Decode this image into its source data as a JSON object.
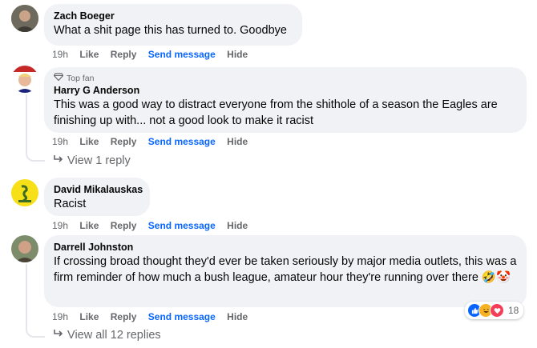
{
  "comments": [
    {
      "name": "Zach Boeger",
      "text": "What a shit page this has turned to. Goodbye",
      "actions": {
        "time": "19h",
        "like": "Like",
        "reply": "Reply",
        "send_message": "Send message",
        "hide": "Hide"
      }
    },
    {
      "badge": "Top fan",
      "name": "Harry G Anderson",
      "text": "This was a good way to distract everyone from the shithole of a season the Eagles are finishing up with... not a good look to make it racist",
      "actions": {
        "time": "19h",
        "like": "Like",
        "reply": "Reply",
        "send_message": "Send message",
        "hide": "Hide"
      },
      "replies_label": "View 1 reply"
    },
    {
      "name": "David Mikalauskas",
      "text": "Racist",
      "actions": {
        "time": "19h",
        "like": "Like",
        "reply": "Reply",
        "send_message": "Send message",
        "hide": "Hide"
      }
    },
    {
      "name": "Darrell Johnston",
      "text": "If crossing broad thought they'd ever be taken seriously by major media outlets, this was a firm reminder of how much a bush league, amateur hour they're running over there",
      "emojis": "🤣🤡",
      "actions": {
        "time": "19h",
        "like": "Like",
        "reply": "Reply",
        "send_message": "Send message",
        "hide": "Hide"
      },
      "reaction_count": "18",
      "reaction_icons": [
        "like-icon",
        "haha-icon",
        "love-icon"
      ],
      "replies_label": "View all 12 replies"
    }
  ],
  "colors": {
    "bubble": "#f0f2f5",
    "link": "#0866ff",
    "meta": "#65676b",
    "like": "#0866ff",
    "love": "#f33e58",
    "haha": "#f7b125"
  }
}
